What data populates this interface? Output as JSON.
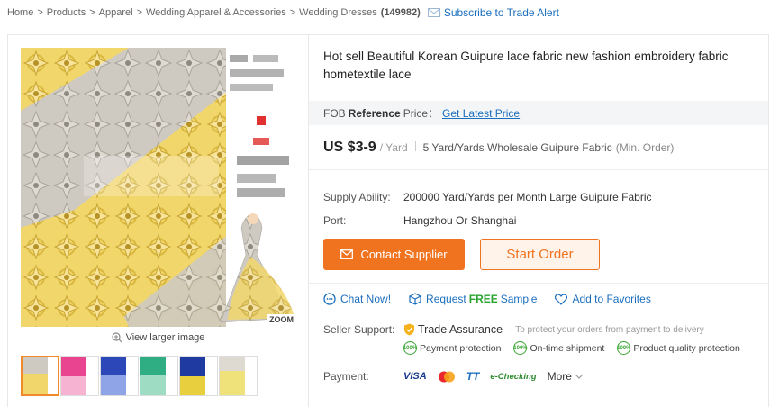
{
  "breadcrumb": {
    "items": [
      "Home",
      "Products",
      "Apparel",
      "Wedding Apparel & Accessories",
      "Wedding Dresses"
    ],
    "separator": ">",
    "count": "(149982)",
    "alert_label": "Subscribe to Trade Alert"
  },
  "gallery": {
    "zoom_label": "ZOOM",
    "view_larger_label": "View larger image"
  },
  "product": {
    "title": "Hot sell Beautiful Korean Guipure lace fabric new fashion embroidery fabric hometextile lace",
    "fob_prefix": "FOB",
    "fob_reference": "Reference",
    "fob_price_label": "Price：",
    "fob_link": "Get Latest Price",
    "price": "US $3-9",
    "price_unit": "/ Yard",
    "moq": "5 Yard/Yards Wholesale Guipure Fabric",
    "moq_note": "(Min. Order)",
    "specs": [
      {
        "label": "Supply Ability:",
        "value": "200000 Yard/Yards per Month Large Guipure Fabric"
      },
      {
        "label": "Port:",
        "value": "Hangzhou Or Shanghai"
      }
    ]
  },
  "buttons": {
    "contact": "Contact Supplier",
    "order": "Start Order"
  },
  "actions": {
    "chat": "Chat Now!",
    "sample_prefix": "Request",
    "sample_free": "FREE",
    "sample_suffix": "Sample",
    "favorites": "Add to Favorites"
  },
  "seller_support": {
    "label": "Seller Support:",
    "trade_assurance": "Trade Assurance",
    "description": "– To protect your orders from payment to delivery",
    "badge_text": "100%",
    "guarantees": [
      "Payment protection",
      "On-time shipment",
      "Product quality protection"
    ]
  },
  "payment": {
    "label": "Payment:",
    "methods": [
      "VISA",
      "TT",
      "e-Checking"
    ],
    "more": "More"
  },
  "colors": {
    "accent_orange": "#f07320",
    "link_blue": "#1a6ebd",
    "free_green": "#2aa330",
    "lace_yellow": "#f0d468",
    "lace_grey": "#c9c5bd"
  }
}
